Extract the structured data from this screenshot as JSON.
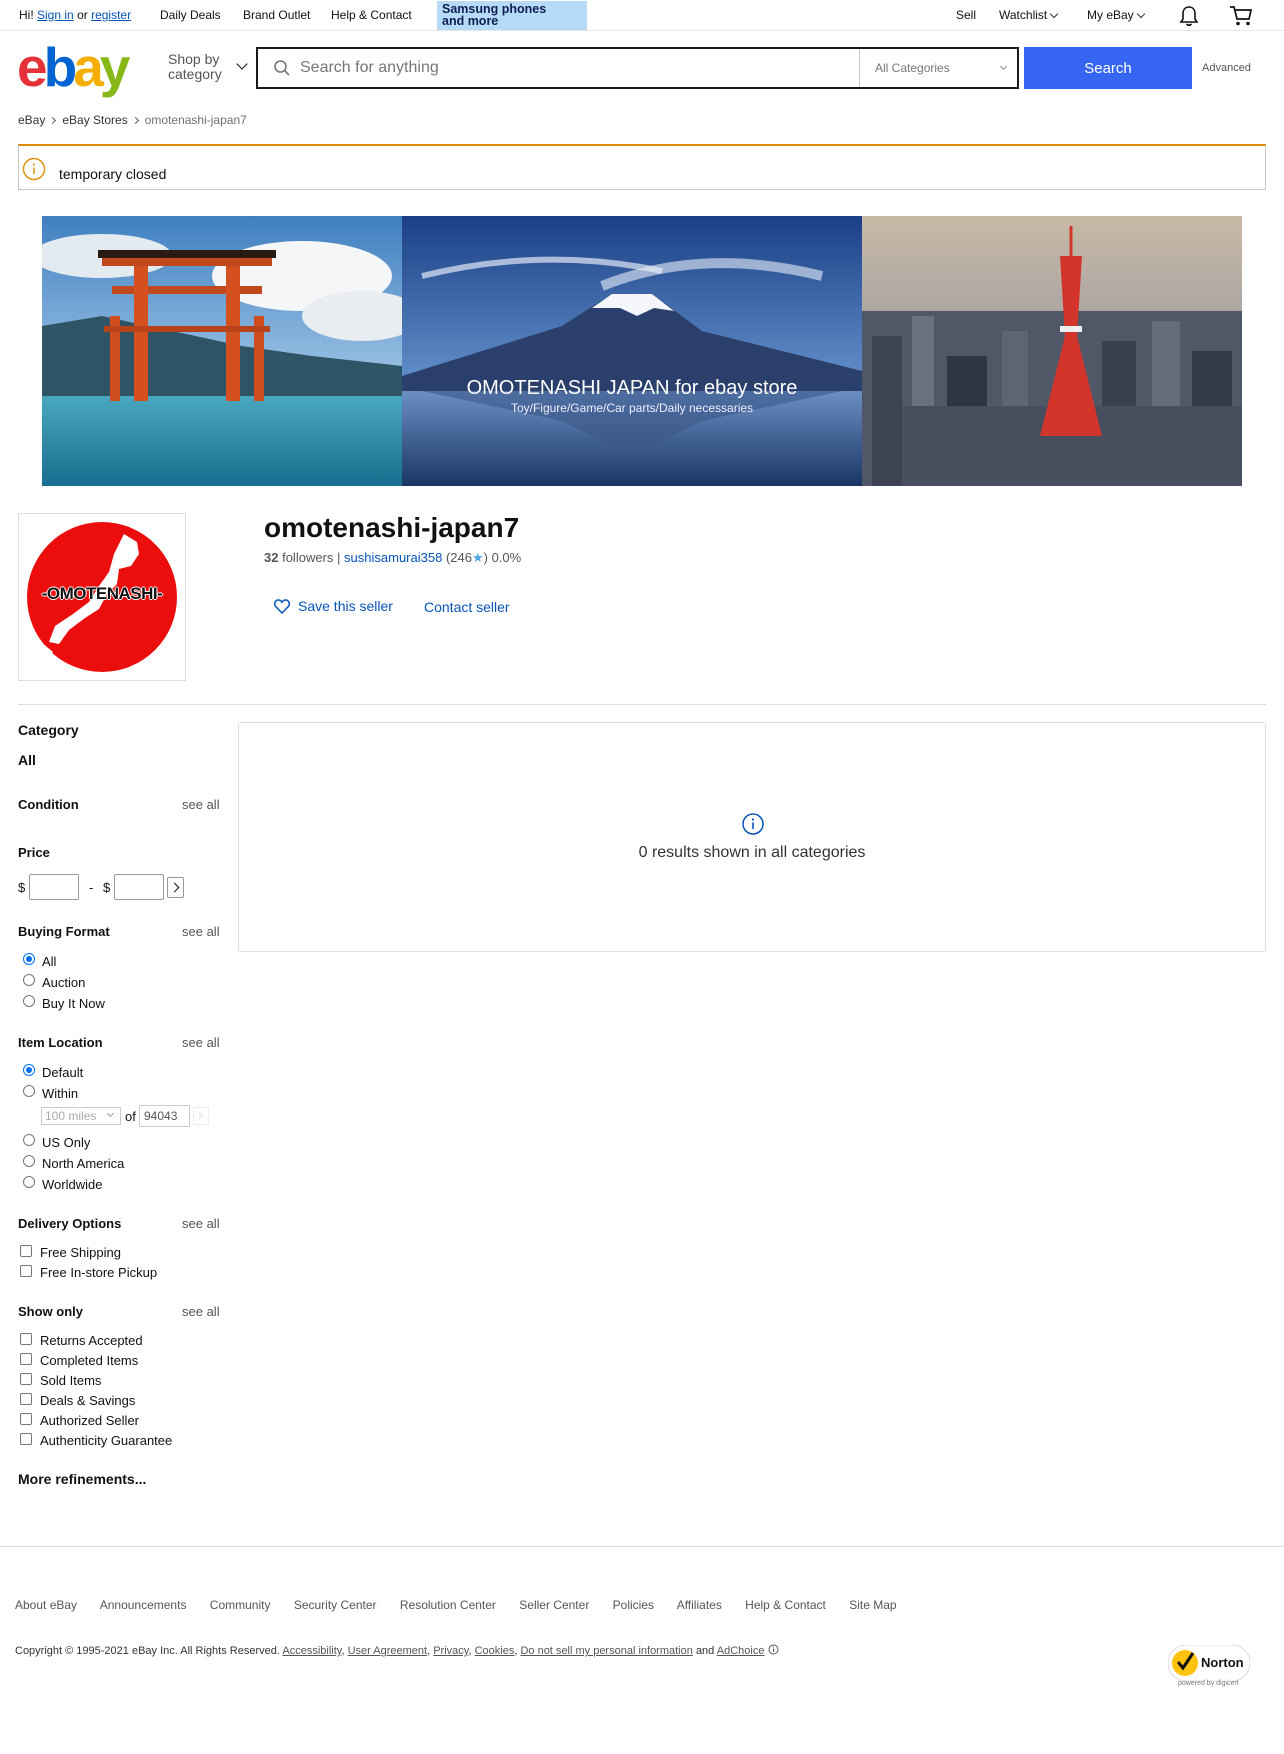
{
  "topbar": {
    "greeting": "Hi!",
    "sign_in": "Sign in",
    "or": "or",
    "register": "register",
    "daily_deals": "Daily Deals",
    "brand_outlet": "Brand Outlet",
    "help_contact": "Help & Contact",
    "promo_line1": "Samsung phones",
    "promo_line2": "and more",
    "sell": "Sell",
    "watchlist": "Watchlist",
    "my_ebay": "My eBay"
  },
  "header": {
    "logo_letters": [
      "e",
      "b",
      "a",
      "y"
    ],
    "logo_colors": [
      "#e53238",
      "#0064d2",
      "#f5af02",
      "#86b817"
    ],
    "shop_by_line1": "Shop by",
    "shop_by_line2": "category",
    "search_placeholder": "Search for anything",
    "category_select": "All Categories",
    "search_button": "Search",
    "advanced": "Advanced",
    "accent_color": "#3665f3"
  },
  "breadcrumb": [
    "eBay",
    "eBay Stores",
    "omotenashi-japan7"
  ],
  "notice": {
    "text": "temporary closed",
    "color": "#dd8e00"
  },
  "banner": {
    "title": "OMOTENASHI JAPAN for ebay store",
    "subtitle": "Toy/Figure/Game/Car parts/Daily necessaries"
  },
  "store": {
    "logo_text": "-OMOTENASHI-",
    "name": "omotenashi-japan7",
    "followers_count": "32",
    "followers_label": "followers",
    "separator": "|",
    "username": "sushisamurai358",
    "feedback_open": "(246",
    "feedback_close": ") 0.0%",
    "save_seller": "Save this seller",
    "contact_seller": "Contact seller"
  },
  "facets": {
    "see_all": "see all",
    "category": {
      "title": "Category",
      "value": "All"
    },
    "condition": {
      "title": "Condition"
    },
    "price": {
      "title": "Price",
      "currency": "$",
      "dash": "-"
    },
    "buying_format": {
      "title": "Buying Format",
      "options": [
        "All",
        "Auction",
        "Buy It Now"
      ],
      "selected": "All"
    },
    "item_location": {
      "title": "Item Location",
      "options": [
        "Default",
        "Within",
        "US Only",
        "North America",
        "Worldwide"
      ],
      "selected": "Default",
      "distance": "100 miles",
      "of": "of",
      "zip": "94043"
    },
    "delivery": {
      "title": "Delivery Options",
      "options": [
        "Free Shipping",
        "Free In-store Pickup"
      ]
    },
    "show_only": {
      "title": "Show only",
      "options": [
        "Returns Accepted",
        "Completed Items",
        "Sold Items",
        "Deals & Savings",
        "Authorized Seller",
        "Authenticity Guarantee"
      ]
    },
    "more": "More refinements..."
  },
  "results": {
    "text": "0 results shown in all categories"
  },
  "footer": {
    "links": [
      "About eBay",
      "Announcements",
      "Community",
      "Security Center",
      "Resolution Center",
      "Seller Center",
      "Policies",
      "Affiliates",
      "Help & Contact",
      "Site Map"
    ],
    "copyright": "Copyright © 1995-2021 eBay Inc. All Rights Reserved.",
    "legal": [
      "Accessibility",
      "User Agreement",
      "Privacy",
      "Cookies",
      "Do not sell my personal information"
    ],
    "and": "and",
    "adchoice": "AdChoice",
    "norton": "Norton",
    "norton_sub": "powered by digicert"
  }
}
